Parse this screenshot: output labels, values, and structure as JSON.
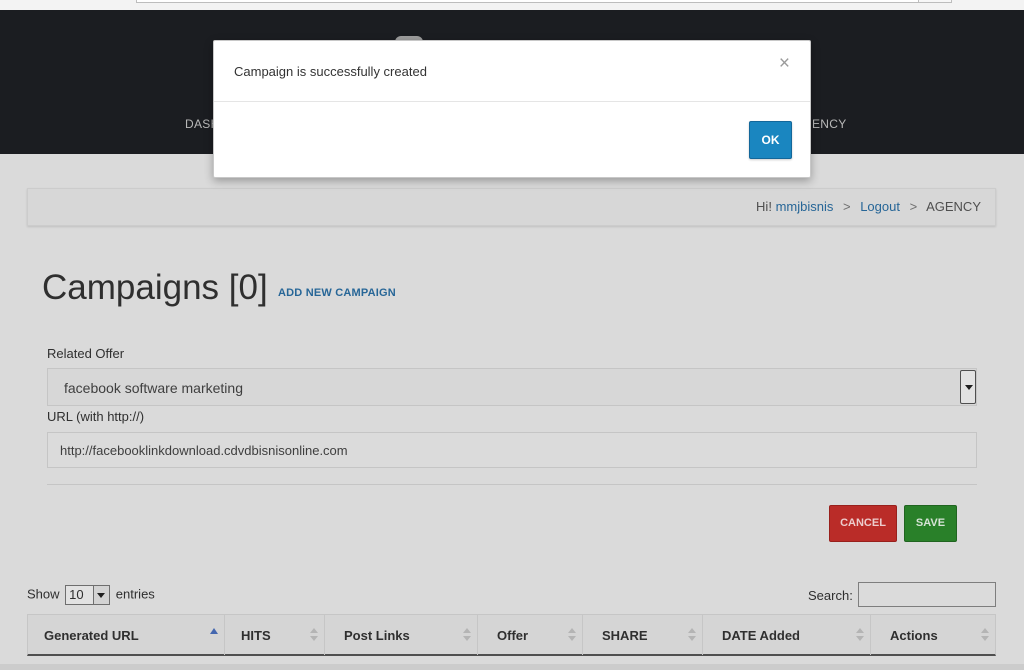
{
  "nav": {
    "left_label": "DASH",
    "right_label": "ENCY"
  },
  "breadcrumb": {
    "greeting": "Hi!",
    "username": "mmjbisnis",
    "separator": ">",
    "logout": "Logout",
    "current": "AGENCY"
  },
  "page": {
    "title": "Campaigns [0]",
    "add_new_link": "ADD NEW CAMPAIGN"
  },
  "form": {
    "related_offer_label": "Related Offer",
    "related_offer_value": "facebook software marketing",
    "url_label": "URL (with http://)",
    "url_value": "http://facebooklinkdownload.cdvdbisnisonline.com",
    "cancel_label": "CANCEL",
    "save_label": "SAVE"
  },
  "table": {
    "show_label": "Show",
    "entries_value": "10",
    "entries_label": "entries",
    "search_label": "Search:",
    "columns": [
      "Generated URL",
      "HITS",
      "Post Links",
      "Offer",
      "SHARE",
      "DATE Added",
      "Actions"
    ]
  },
  "modal": {
    "message": "Campaign is successfully created",
    "close_glyph": "×",
    "ok_label": "OK"
  },
  "colors": {
    "header_bg": "#1e2024",
    "link": "#2a6ea3",
    "cancel": "#c9302c",
    "save": "#2d8a2d",
    "ok": "#1a86c0"
  }
}
